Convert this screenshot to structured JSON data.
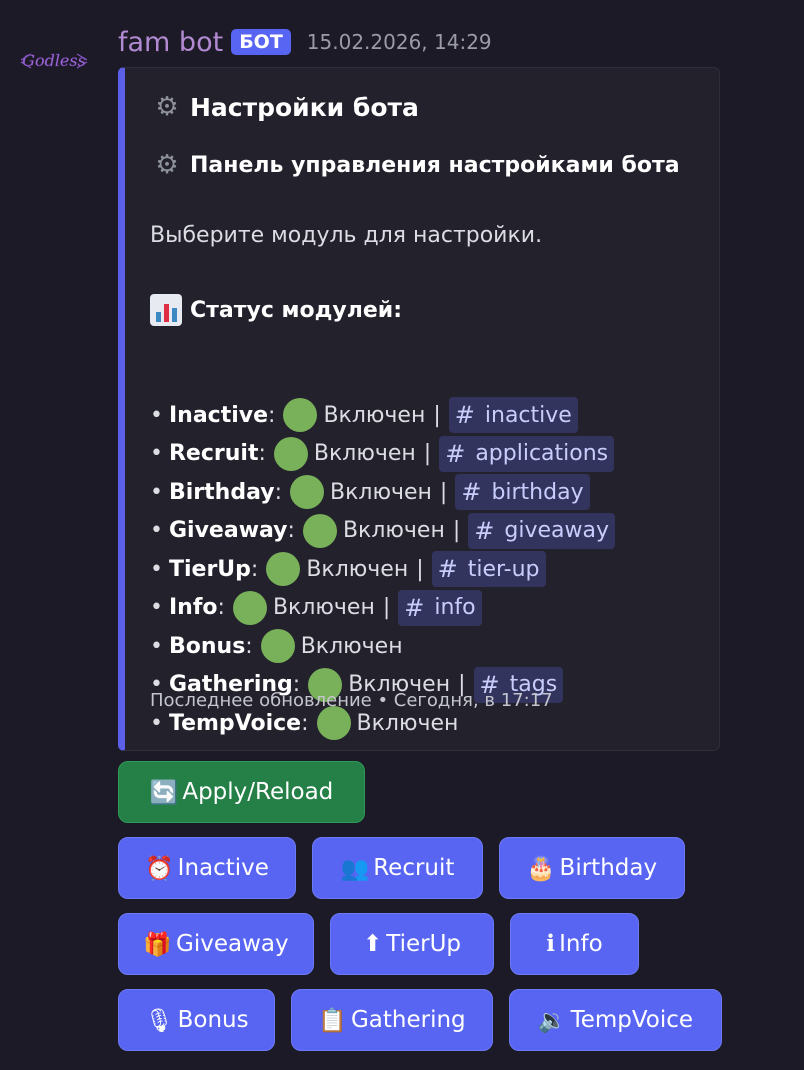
{
  "message": {
    "author": "fam bot",
    "bot_tag": "БОТ",
    "timestamp": "15.02.2026, 14:29",
    "avatar_text": "Godless"
  },
  "embed": {
    "title": "Настройки бота",
    "subtitle": "Панель управления настройками бота",
    "description": "Выберите модуль для настройки.",
    "status_heading": "Статус модулей:",
    "state_label": "Включен",
    "modules": [
      {
        "name": "Inactive",
        "channel": "inactive"
      },
      {
        "name": "Recruit",
        "channel": "applications"
      },
      {
        "name": "Birthday",
        "channel": "birthday"
      },
      {
        "name": "Giveaway",
        "channel": "giveaway"
      },
      {
        "name": "TierUp",
        "channel": "tier-up"
      },
      {
        "name": "Info",
        "channel": "info"
      },
      {
        "name": "Bonus",
        "channel": ""
      },
      {
        "name": "Gathering",
        "channel": "tags"
      },
      {
        "name": "TempVoice",
        "channel": ""
      }
    ],
    "footer": "Последнее обновление • Сегодня, в 17:17"
  },
  "buttons": {
    "apply": {
      "emoji": "🔄",
      "label": "Apply/Reload"
    },
    "inactive": {
      "emoji": "⏰",
      "label": "Inactive"
    },
    "recruit": {
      "emoji": "👥",
      "label": "Recruit"
    },
    "birthday": {
      "emoji": "🎂",
      "label": "Birthday"
    },
    "giveaway": {
      "emoji": "🎁",
      "label": "Giveaway"
    },
    "tierup": {
      "emoji": "⬆",
      "label": "TierUp"
    },
    "info": {
      "emoji": "ℹ",
      "label": "Info"
    },
    "bonus": {
      "emoji": "🎙",
      "label": "Bonus"
    },
    "gathering": {
      "emoji": "📋",
      "label": "Gathering"
    },
    "tempvoice": {
      "emoji": "🔉",
      "label": "TempVoice"
    }
  },
  "colors": {
    "accent": "#5865f2",
    "success": "#248046",
    "status_on": "#78b159",
    "author": "#b18ad2"
  },
  "icons": {
    "gear": "gear-icon",
    "chart": "bar-chart-icon",
    "hash": "channel-hash-icon"
  }
}
